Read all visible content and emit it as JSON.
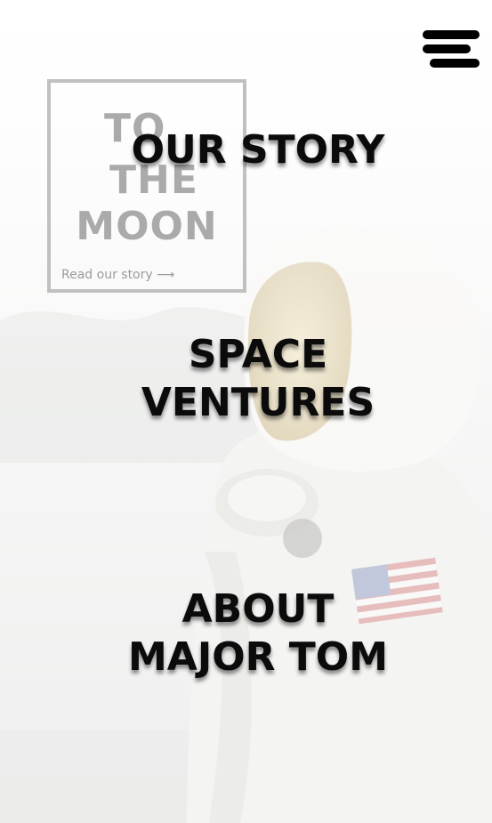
{
  "title_card": {
    "line1": "TO",
    "line2": "THE",
    "line3": "MOON",
    "link": "Read our story ⟶"
  },
  "menu": {
    "icon": "hamburger-icon",
    "items": [
      {
        "line1": "OUR STORY",
        "line2": ""
      },
      {
        "line1": "SPACE",
        "line2": "VENTURES"
      },
      {
        "line1": "ABOUT",
        "line2": "MAJOR TOM"
      }
    ]
  },
  "colors": {
    "text": "#0b0b0b",
    "card_border": "#b9b9b9"
  }
}
